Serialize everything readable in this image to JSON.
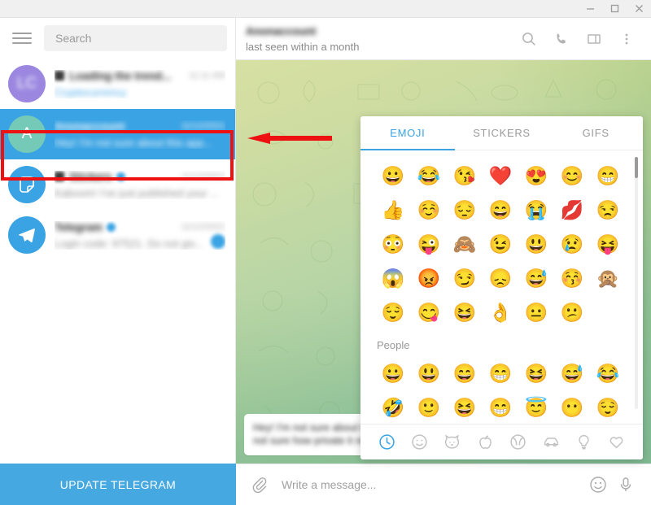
{
  "window": {
    "minimize_label": "Minimize",
    "maximize_label": "Maximize",
    "close_label": "Close"
  },
  "sidebar": {
    "search": {
      "placeholder": "Search",
      "value": ""
    },
    "menu_label": "Menu",
    "update_button_label": "UPDATE TELEGRAM",
    "chats": [
      {
        "name": "Loading the trend...",
        "time": "11:11 AM",
        "message": "Cryptocurrency",
        "avatar_initials": "LC",
        "avatar_color": "#9b87e0",
        "selected": false,
        "message_is_link": true,
        "verified": false,
        "has_prefix_icon": true,
        "unread_badge": false
      },
      {
        "name": "Anonaccount",
        "time": "11/12/2021",
        "message": "Hey! I'm not sure about this app...",
        "avatar_initials": "A",
        "avatar_color": "#75c9b7",
        "selected": true,
        "message_is_link": false,
        "verified": false,
        "has_prefix_icon": false,
        "unread_badge": false
      },
      {
        "name": "Stickers",
        "time": "11/12/2021",
        "message": "Kaboom! I've just published your ...",
        "avatar_initials": "",
        "avatar_color": "#3aa3e3",
        "avatar_icon": "sticker-icon",
        "selected": false,
        "message_is_link": false,
        "verified": true,
        "has_prefix_icon": true,
        "unread_badge": false
      },
      {
        "name": "Telegram",
        "time": "11/12/2021",
        "message": "Login code: 97521. Do not giv...",
        "avatar_initials": "",
        "avatar_color": "#3aa3e3",
        "avatar_icon": "telegram-plane-icon",
        "selected": false,
        "message_is_link": false,
        "verified": true,
        "has_prefix_icon": false,
        "unread_badge": true
      }
    ]
  },
  "chat": {
    "title": "Anonaccount",
    "status": "last seen within a month",
    "header_icons": [
      "search-icon",
      "phone-icon",
      "panel-toggle-icon",
      "more-vertical-icon"
    ],
    "message_bubble": {
      "line1": "Hey! I'm not sure about this app, I'm",
      "line2": "not sure how private it really is"
    },
    "annotation": {
      "type": "arrow-left",
      "color": "#ee1111"
    }
  },
  "composer": {
    "attach_icon": "paperclip-icon",
    "placeholder": "Write a message...",
    "value": "",
    "emoji_icon": "smiley-icon",
    "voice_icon": "microphone-icon"
  },
  "emoji_panel": {
    "tabs": [
      {
        "label": "EMOJI",
        "active": true
      },
      {
        "label": "STICKERS",
        "active": false
      },
      {
        "label": "GIFS",
        "active": false
      }
    ],
    "recent_rows": [
      [
        "😀",
        "😂",
        "😘",
        "❤️",
        "😍",
        "😊",
        "😁"
      ],
      [
        "👍",
        "☺️",
        "😔",
        "😄",
        "😭",
        "💋",
        "😒"
      ],
      [
        "😳",
        "😜",
        "🙈",
        "😉",
        "😃",
        "😢",
        "😝"
      ],
      [
        "😱",
        "😡",
        "😏",
        "😞",
        "😅",
        "😚",
        "🙊"
      ],
      [
        "😌",
        "😋",
        "😆",
        "👌",
        "😐",
        "😕"
      ]
    ],
    "section_label": "People",
    "people_rows": [
      [
        "😀",
        "😃",
        "😄",
        "😁",
        "😆",
        "😅",
        "😂"
      ],
      [
        "🤣",
        "🙂",
        "😆",
        "😁",
        "😇",
        "😶",
        "😌"
      ]
    ],
    "category_icons": [
      {
        "name": "recent-clock-icon",
        "active": true
      },
      {
        "name": "smiley-icon",
        "active": false
      },
      {
        "name": "cat-icon",
        "active": false
      },
      {
        "name": "apple-icon",
        "active": false
      },
      {
        "name": "ball-icon",
        "active": false
      },
      {
        "name": "car-icon",
        "active": false
      },
      {
        "name": "lightbulb-icon",
        "active": false
      },
      {
        "name": "heart-icon",
        "active": false
      }
    ]
  },
  "colors": {
    "accent": "#3aa3e3",
    "selected_row": "#3aa3e3",
    "annotation_red": "#ee1111",
    "update_button": "#45a8e0"
  }
}
